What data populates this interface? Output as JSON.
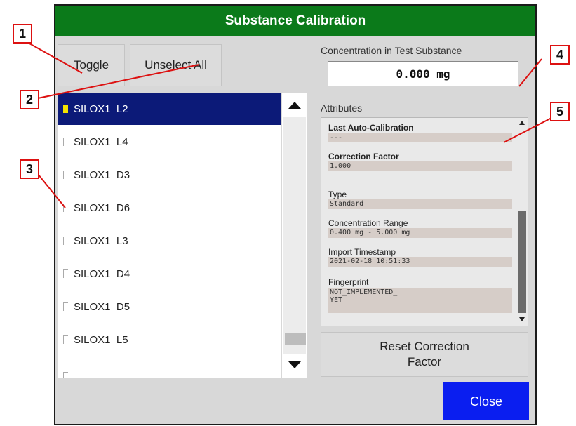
{
  "dialog": {
    "title": "Substance Calibration"
  },
  "toolbar": {
    "toggle_label": "Toggle",
    "unselect_all_label": "Unselect All"
  },
  "substances": [
    {
      "name": "SILOX1_L2",
      "checked": true,
      "selected": true
    },
    {
      "name": "SILOX1_L4",
      "checked": false,
      "selected": false
    },
    {
      "name": "SILOX1_D3",
      "checked": false,
      "selected": false
    },
    {
      "name": "SILOX1_D6",
      "checked": false,
      "selected": false
    },
    {
      "name": "SILOX1_L3",
      "checked": false,
      "selected": false
    },
    {
      "name": "SILOX1_D4",
      "checked": false,
      "selected": false
    },
    {
      "name": "SILOX1_D5",
      "checked": false,
      "selected": false
    },
    {
      "name": "SILOX1_L5",
      "checked": false,
      "selected": false
    }
  ],
  "concentration": {
    "label": "Concentration in Test Substance",
    "value": "0.000 mg"
  },
  "attributes": {
    "title": "Attributes",
    "last_auto_calibration": {
      "label": "Last Auto-Calibration",
      "value": "---"
    },
    "correction_factor": {
      "label": "Correction Factor",
      "value": "1.000"
    },
    "type": {
      "label": "Type",
      "value": "Standard"
    },
    "concentration_range": {
      "label": "Concentration Range",
      "value": "0.400 mg - 5.000 mg"
    },
    "import_timestamp": {
      "label": "Import Timestamp",
      "value": "2021-02-18 10:51:33"
    },
    "fingerprint": {
      "label": "Fingerprint",
      "value_line1": "NOT_IMPLEMENTED_",
      "value_line2": "YET"
    }
  },
  "reset_button": {
    "line1": "Reset Correction",
    "line2": "Factor"
  },
  "close_label": "Close",
  "callouts": [
    "1",
    "2",
    "3",
    "4",
    "5"
  ],
  "colors": {
    "title_bar": "#0b7a1a",
    "selected_row": "#0c1a78",
    "close_button": "#0a1ef0",
    "callout_border": "#dd1111",
    "checkbox_on": "#f4e400"
  }
}
